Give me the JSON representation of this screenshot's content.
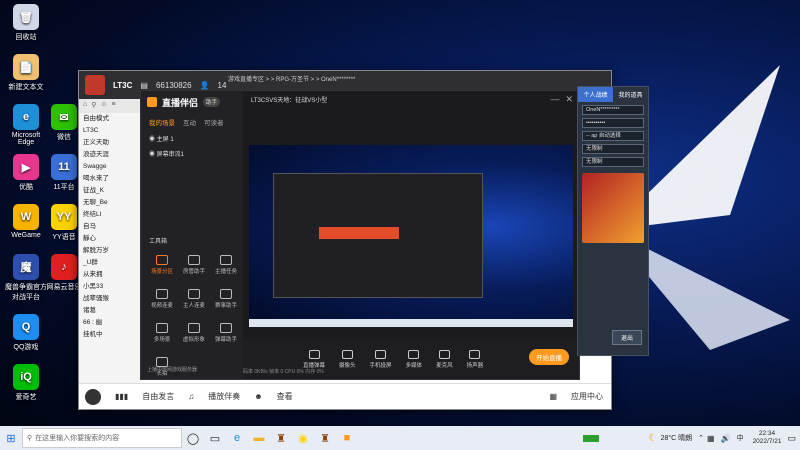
{
  "desktop": {
    "icons": [
      {
        "label": "回收站",
        "glyph": "🗑",
        "color": "#cfd8e6"
      },
      {
        "label": "新建文本文",
        "glyph": "📄",
        "color": "#f0c070"
      },
      {
        "label": "Microsoft Edge",
        "glyph": "e",
        "color": "#1f8fd8"
      },
      {
        "label": "微信",
        "glyph": "✉",
        "color": "#2dc100"
      },
      {
        "label": "优酷",
        "glyph": "▶",
        "color": "#e8368f"
      },
      {
        "label": "11平台",
        "glyph": "11",
        "color": "#3b6fd8"
      },
      {
        "label": "WeGame",
        "glyph": "W",
        "color": "#f6b400"
      },
      {
        "label": "YY语音",
        "glyph": "YY",
        "color": "#ffd200"
      },
      {
        "label": "魔兽争霸官方对战平台",
        "glyph": "魔",
        "color": "#2d4fae"
      },
      {
        "label": "网易云音乐",
        "glyph": "♪",
        "color": "#e02020"
      },
      {
        "label": "QQ游戏",
        "glyph": "Q",
        "color": "#1b8ef0"
      },
      {
        "label": "爱奇艺",
        "glyph": "iQ",
        "color": "#00be06"
      }
    ]
  },
  "yy": {
    "channel_title": "LT3C",
    "room_id": "66130826",
    "user_count": "14",
    "tree": [
      "自由模式",
      "LT3C",
      "正义天助",
      "浪迹天涯",
      "Swagge",
      "喝水来了",
      "征战_K",
      "无聊_Be",
      "终结LI",
      "自马",
      "靜心",
      "解脱万岁",
      "_U群",
      "从来拥",
      "小黑33",
      "战辈骚猴",
      "诸葛",
      "66 : 幽",
      "挂机中"
    ],
    "bottom_bar": {
      "free_mic": "自由发言",
      "song_label": "播放伴奏",
      "chat_label": "查看",
      "app_center": "应用中心"
    }
  },
  "zb": {
    "app_name": "直播伴侣",
    "badge": "助手",
    "tabs": [
      "我的场景",
      "互动",
      "可读者"
    ],
    "scenes": [
      "主屏 1",
      "屏幕串流1"
    ],
    "toolbox_label": "工具箱",
    "tools": [
      "场景分区",
      "房管助手",
      "主播任务",
      "视频连麦",
      "主人连麦",
      "赛事助手",
      "多场景",
      "虚拟形象",
      "弹幕助手",
      "长拍"
    ],
    "live_title": "LT3CSVS天地：征战VS小型",
    "stream_title_bar": "游戏直播专区 > > RPG-万圣节 > > OneN********",
    "bottom_buttons": [
      "直播弹幕",
      "摄像头",
      "手机投屏",
      "多媒体",
      "麦克风",
      "扬声器"
    ],
    "start_button": "开始直播",
    "status_bar": "码率 0KB/s   帧率 0   CPU 0%   内存 0%",
    "notification": "上播中房网游戏服务器"
  },
  "panel": {
    "tabs": [
      "个人战绩",
      "我的道具"
    ],
    "fields": [
      "OneN*********",
      "••••••••••",
      "-- ap 自动选择",
      "无限制",
      "无限制"
    ],
    "btn": "退出"
  },
  "taskbar": {
    "search_placeholder": "在这里输入你要搜索的内容",
    "weather": "28°C 晴朗",
    "language": "中",
    "time": "22:34",
    "date": "2022/7/21"
  }
}
